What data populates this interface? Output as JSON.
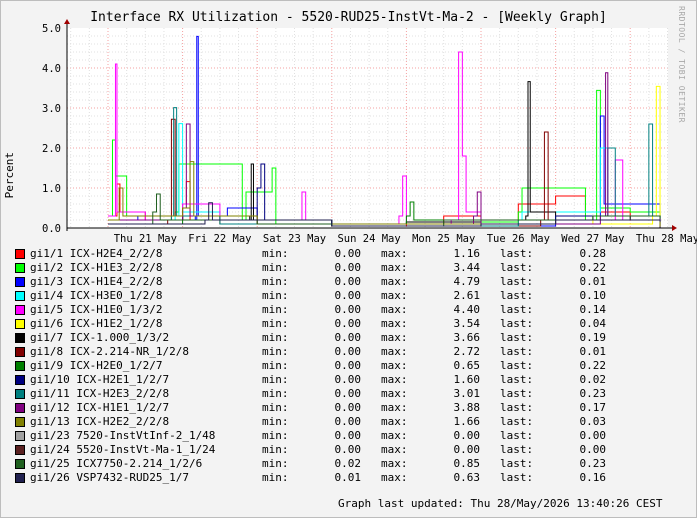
{
  "page": {
    "title": "Interface RX Utilization - 5520-RUD25-InstVt-Ma-2 - [Weekly Graph]",
    "watermark": "RRDTOOL / TOBI OETIKER",
    "updated": "Graph last updated: Thu 28/May/2026 13:40:26 CEST",
    "stat_labels": {
      "min": "min:",
      "max": "max:",
      "last": "last:"
    }
  },
  "chart_data": {
    "type": "line",
    "title": "Interface RX Utilization - 5520-RUD25-InstVt-Ma-2 - [Weekly Graph]",
    "ylabel": "Percent",
    "xlabel": "",
    "ylim": [
      0,
      5
    ],
    "y_ticks": [
      "0.0",
      "1.0",
      "2.0",
      "3.0",
      "4.0",
      "5.0"
    ],
    "x_ticks": [
      "Thu 21 May",
      "Fri 22 May",
      "Sat 23 May",
      "Sun 24 May",
      "Mon 25 May",
      "Tue 26 May",
      "Wed 27 May",
      "Thu 28 May"
    ],
    "grid": true,
    "series": [
      {
        "name": "gi1/1 ICX-H2E4_2/2/8",
        "color": "#ff0000",
        "min": "0.00",
        "max": "1.16",
        "last": "0.28",
        "points": [
          [
            0.1,
            0.3
          ],
          [
            0.12,
            1.1
          ],
          [
            0.16,
            0.4
          ],
          [
            0.5,
            0.2
          ],
          [
            1.0,
            0.6
          ],
          [
            1.05,
            1.16
          ],
          [
            1.1,
            0.2
          ],
          [
            2.0,
            0.1
          ],
          [
            3.0,
            0.05
          ],
          [
            4.0,
            0.1
          ],
          [
            4.5,
            0.3
          ],
          [
            5.0,
            0.2
          ],
          [
            5.5,
            0.6
          ],
          [
            6.0,
            0.8
          ],
          [
            6.4,
            0.4
          ],
          [
            7.0,
            0.3
          ],
          [
            7.4,
            0.28
          ]
        ]
      },
      {
        "name": "gi1/2 ICX-H1E3_2/2/8",
        "color": "#00ff00",
        "min": "0.00",
        "max": "3.44",
        "last": "0.22",
        "points": [
          [
            0.0,
            0.3
          ],
          [
            0.06,
            2.2
          ],
          [
            0.1,
            1.3
          ],
          [
            0.25,
            0.3
          ],
          [
            0.9,
            0.4
          ],
          [
            0.95,
            1.6
          ],
          [
            1.8,
            0.2
          ],
          [
            1.85,
            0.9
          ],
          [
            2.2,
            1.5
          ],
          [
            2.25,
            0.1
          ],
          [
            4.0,
            0.15
          ],
          [
            5.5,
            0.4
          ],
          [
            5.55,
            1.0
          ],
          [
            6.4,
            0.2
          ],
          [
            6.55,
            3.44
          ],
          [
            6.6,
            0.5
          ],
          [
            7.0,
            0.4
          ],
          [
            7.4,
            0.22
          ]
        ]
      },
      {
        "name": "gi1/3 ICX-H1E4_2/2/8",
        "color": "#0000ff",
        "min": "0.00",
        "max": "4.79",
        "last": "0.01",
        "points": [
          [
            0.0,
            0.2
          ],
          [
            0.4,
            0.3
          ],
          [
            1.17,
            0.2
          ],
          [
            1.19,
            4.79
          ],
          [
            1.21,
            0.3
          ],
          [
            1.6,
            0.5
          ],
          [
            2.0,
            0.2
          ],
          [
            3.0,
            0.05
          ],
          [
            5.0,
            0.05
          ],
          [
            6.0,
            0.3
          ],
          [
            6.6,
            2.8
          ],
          [
            6.65,
            0.6
          ],
          [
            7.4,
            0.01
          ]
        ]
      },
      {
        "name": "gi1/4 ICX-H3E0_1/2/8",
        "color": "#00ffff",
        "min": "0.00",
        "max": "2.61",
        "last": "0.10",
        "points": [
          [
            0.0,
            0.2
          ],
          [
            0.9,
            0.3
          ],
          [
            0.95,
            2.61
          ],
          [
            1.0,
            0.4
          ],
          [
            1.5,
            0.2
          ],
          [
            3.0,
            0.05
          ],
          [
            5.5,
            0.2
          ],
          [
            5.55,
            0.4
          ],
          [
            6.6,
            2.0
          ],
          [
            6.7,
            0.3
          ],
          [
            7.4,
            0.1
          ]
        ]
      },
      {
        "name": "gi1/5 ICX-H1E0_1/3/2",
        "color": "#ff00ff",
        "min": "0.00",
        "max": "4.40",
        "last": "0.14",
        "points": [
          [
            0.0,
            0.3
          ],
          [
            0.1,
            4.1
          ],
          [
            0.12,
            0.4
          ],
          [
            0.5,
            0.2
          ],
          [
            1.0,
            0.6
          ],
          [
            1.5,
            0.2
          ],
          [
            2.6,
            0.9
          ],
          [
            2.65,
            0.2
          ],
          [
            3.0,
            0.1
          ],
          [
            3.9,
            0.3
          ],
          [
            3.95,
            1.3
          ],
          [
            4.0,
            0.1
          ],
          [
            4.6,
            0.2
          ],
          [
            4.7,
            4.4
          ],
          [
            4.75,
            1.8
          ],
          [
            4.8,
            0.4
          ],
          [
            5.0,
            0.2
          ],
          [
            6.3,
            0.2
          ],
          [
            6.8,
            1.7
          ],
          [
            6.9,
            0.2
          ],
          [
            7.4,
            0.14
          ]
        ]
      },
      {
        "name": "gi1/6 ICX-H1E2_1/2/8",
        "color": "#ffff00",
        "min": "0.00",
        "max": "3.54",
        "last": "0.04",
        "points": [
          [
            0.0,
            0.2
          ],
          [
            1.0,
            0.3
          ],
          [
            1.5,
            0.1
          ],
          [
            3.0,
            0.05
          ],
          [
            5.0,
            0.1
          ],
          [
            5.5,
            0.2
          ],
          [
            6.0,
            0.3
          ],
          [
            6.5,
            0.1
          ],
          [
            7.3,
            0.3
          ],
          [
            7.35,
            3.54
          ],
          [
            7.4,
            0.04
          ]
        ]
      },
      {
        "name": "gi1/7 ICX-1.000_1/3/2",
        "color": "#000000",
        "min": "0.00",
        "max": "3.66",
        "last": "0.19",
        "points": [
          [
            0.0,
            0.2
          ],
          [
            1.0,
            0.3
          ],
          [
            1.9,
            0.2
          ],
          [
            1.92,
            1.6
          ],
          [
            1.95,
            0.2
          ],
          [
            2.5,
            0.2
          ],
          [
            3.0,
            0.1
          ],
          [
            4.0,
            0.15
          ],
          [
            5.0,
            0.2
          ],
          [
            5.6,
            0.3
          ],
          [
            5.63,
            3.66
          ],
          [
            5.66,
            0.4
          ],
          [
            6.0,
            0.3
          ],
          [
            7.0,
            0.2
          ],
          [
            7.4,
            0.19
          ]
        ]
      },
      {
        "name": "gi1/8 ICX-2.214-NR_1/2/8",
        "color": "#800000",
        "min": "0.00",
        "max": "2.72",
        "last": "0.01",
        "points": [
          [
            0.0,
            0.1
          ],
          [
            0.8,
            0.2
          ],
          [
            0.85,
            2.72
          ],
          [
            0.9,
            0.3
          ],
          [
            1.5,
            0.1
          ],
          [
            3.0,
            0.05
          ],
          [
            5.8,
            0.2
          ],
          [
            5.85,
            2.4
          ],
          [
            5.9,
            0.2
          ],
          [
            7.4,
            0.01
          ]
        ]
      },
      {
        "name": "gi1/9 ICX-H2E0_1/2/7",
        "color": "#008000",
        "min": "0.00",
        "max": "0.65",
        "last": "0.22",
        "points": [
          [
            0.0,
            0.1
          ],
          [
            1.0,
            0.3
          ],
          [
            2.0,
            0.2
          ],
          [
            3.0,
            0.1
          ],
          [
            4.0,
            0.3
          ],
          [
            4.05,
            0.65
          ],
          [
            4.1,
            0.2
          ],
          [
            5.0,
            0.2
          ],
          [
            6.0,
            0.3
          ],
          [
            7.0,
            0.3
          ],
          [
            7.4,
            0.22
          ]
        ]
      },
      {
        "name": "gi1/10 ICX-H2E1_1/2/7",
        "color": "#000080",
        "min": "0.00",
        "max": "1.60",
        "last": "0.02",
        "points": [
          [
            0.0,
            0.2
          ],
          [
            1.0,
            0.3
          ],
          [
            2.0,
            1.0
          ],
          [
            2.05,
            1.6
          ],
          [
            2.1,
            0.2
          ],
          [
            3.0,
            0.05
          ],
          [
            5.0,
            0.1
          ],
          [
            6.0,
            0.3
          ],
          [
            6.5,
            0.2
          ],
          [
            7.4,
            0.02
          ]
        ]
      },
      {
        "name": "gi1/11 ICX-H2E3_2/2/8",
        "color": "#008080",
        "min": "0.00",
        "max": "3.01",
        "last": "0.23",
        "points": [
          [
            0.0,
            0.2
          ],
          [
            0.85,
            0.3
          ],
          [
            0.88,
            3.01
          ],
          [
            0.92,
            0.3
          ],
          [
            1.5,
            0.1
          ],
          [
            3.0,
            0.05
          ],
          [
            5.5,
            0.2
          ],
          [
            6.6,
            0.3
          ],
          [
            6.7,
            2.0
          ],
          [
            6.8,
            0.3
          ],
          [
            7.2,
            0.3
          ],
          [
            7.25,
            2.6
          ],
          [
            7.3,
            0.3
          ],
          [
            7.4,
            0.23
          ]
        ]
      },
      {
        "name": "gi1/12 ICX-H1E1_1/2/7",
        "color": "#800080",
        "min": "0.00",
        "max": "3.88",
        "last": "0.17",
        "points": [
          [
            0.0,
            0.2
          ],
          [
            1.0,
            0.5
          ],
          [
            1.05,
            2.6
          ],
          [
            1.1,
            0.3
          ],
          [
            2.0,
            0.1
          ],
          [
            4.0,
            0.1
          ],
          [
            4.9,
            0.3
          ],
          [
            4.95,
            0.9
          ],
          [
            5.0,
            0.1
          ],
          [
            6.6,
            0.3
          ],
          [
            6.67,
            3.88
          ],
          [
            6.7,
            0.3
          ],
          [
            7.4,
            0.17
          ]
        ]
      },
      {
        "name": "gi1/13 ICX-H2E2_2/2/8",
        "color": "#808000",
        "min": "0.00",
        "max": "1.66",
        "last": "0.03",
        "points": [
          [
            0.0,
            0.2
          ],
          [
            0.15,
            1.0
          ],
          [
            0.2,
            0.3
          ],
          [
            1.0,
            0.5
          ],
          [
            1.1,
            1.66
          ],
          [
            1.15,
            0.3
          ],
          [
            2.0,
            0.1
          ],
          [
            4.0,
            0.1
          ],
          [
            6.0,
            0.2
          ],
          [
            7.4,
            0.03
          ]
        ]
      },
      {
        "name": "gi1/23 7520-InstVtInf-2_1/48",
        "color": "#a0a0a0",
        "min": "0.00",
        "max": "0.00",
        "last": "0.00",
        "points": [
          [
            0.0,
            0.0
          ],
          [
            7.4,
            0.0
          ]
        ]
      },
      {
        "name": "gi1/24 5520-InstVt-Ma-1_1/24",
        "color": "#5a2020",
        "min": "0.00",
        "max": "0.00",
        "last": "0.00",
        "points": [
          [
            0.0,
            0.0
          ],
          [
            7.4,
            0.0
          ]
        ]
      },
      {
        "name": "gi1/25 ICX7750-2.214_1/2/6",
        "color": "#1f5f1f",
        "min": "0.02",
        "max": "0.85",
        "last": "0.23",
        "points": [
          [
            0.0,
            0.1
          ],
          [
            0.6,
            0.4
          ],
          [
            0.65,
            0.85
          ],
          [
            0.7,
            0.2
          ],
          [
            2.0,
            0.1
          ],
          [
            3.0,
            0.05
          ],
          [
            4.5,
            0.2
          ],
          [
            5.5,
            0.2
          ],
          [
            6.5,
            0.3
          ],
          [
            7.4,
            0.23
          ]
        ]
      },
      {
        "name": "gi1/26 VSP7432-RUD25_1/7",
        "color": "#20204f",
        "min": "0.01",
        "max": "0.63",
        "last": "0.16",
        "points": [
          [
            0.0,
            0.1
          ],
          [
            1.3,
            0.2
          ],
          [
            1.35,
            0.63
          ],
          [
            1.4,
            0.2
          ],
          [
            3.0,
            0.05
          ],
          [
            5.0,
            0.1
          ],
          [
            6.0,
            0.2
          ],
          [
            7.4,
            0.16
          ]
        ]
      }
    ]
  }
}
